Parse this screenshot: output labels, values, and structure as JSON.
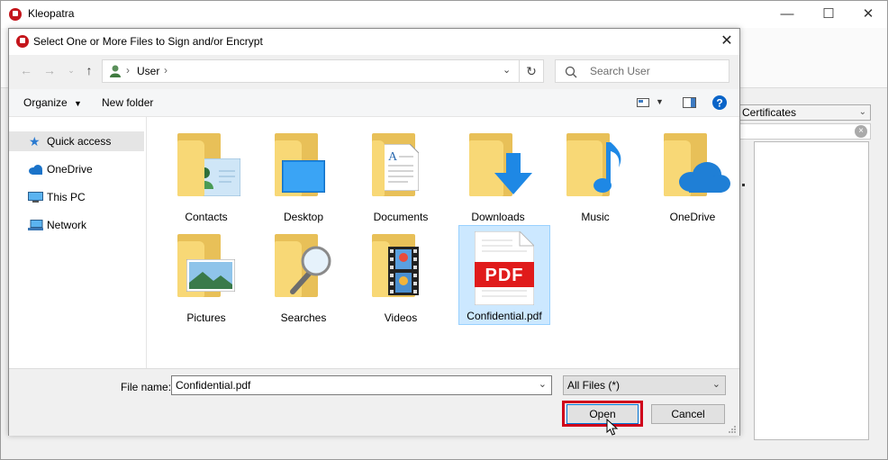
{
  "app": {
    "title": "Kleopatra"
  },
  "background": {
    "combo_value": "Certificates"
  },
  "dialog": {
    "title": "Select One or More Files to Sign and/or Encrypt",
    "breadcrumb": [
      "User"
    ],
    "search_placeholder": "Search User",
    "toolbar": {
      "organize": "Organize",
      "new_folder": "New folder"
    },
    "nav": [
      {
        "label": "Quick access",
        "icon": "star-icon"
      },
      {
        "label": "OneDrive",
        "icon": "cloud-icon"
      },
      {
        "label": "This PC",
        "icon": "computer-icon"
      },
      {
        "label": "Network",
        "icon": "network-icon"
      }
    ],
    "items": [
      {
        "label": "Contacts",
        "icon": "contacts-folder-icon"
      },
      {
        "label": "Desktop",
        "icon": "desktop-folder-icon"
      },
      {
        "label": "Documents",
        "icon": "documents-folder-icon"
      },
      {
        "label": "Downloads",
        "icon": "downloads-folder-icon"
      },
      {
        "label": "Music",
        "icon": "music-folder-icon"
      },
      {
        "label": "OneDrive",
        "icon": "onedrive-folder-icon"
      },
      {
        "label": "Pictures",
        "icon": "pictures-folder-icon"
      },
      {
        "label": "Searches",
        "icon": "searches-folder-icon"
      },
      {
        "label": "Videos",
        "icon": "videos-folder-icon"
      },
      {
        "label": "Confidential.pdf",
        "icon": "pdf-file-icon",
        "selected": true
      }
    ],
    "pdf_badge": "PDF",
    "file_name_label": "File name:",
    "file_name_value": "Confidential.pdf",
    "file_type": "All Files (*)",
    "open_label": "Open",
    "cancel_label": "Cancel",
    "colors": {
      "accent": "#0078d7",
      "highlight": "#d0021b",
      "folder": "#f8d876",
      "selection": "#cce8ff"
    }
  }
}
